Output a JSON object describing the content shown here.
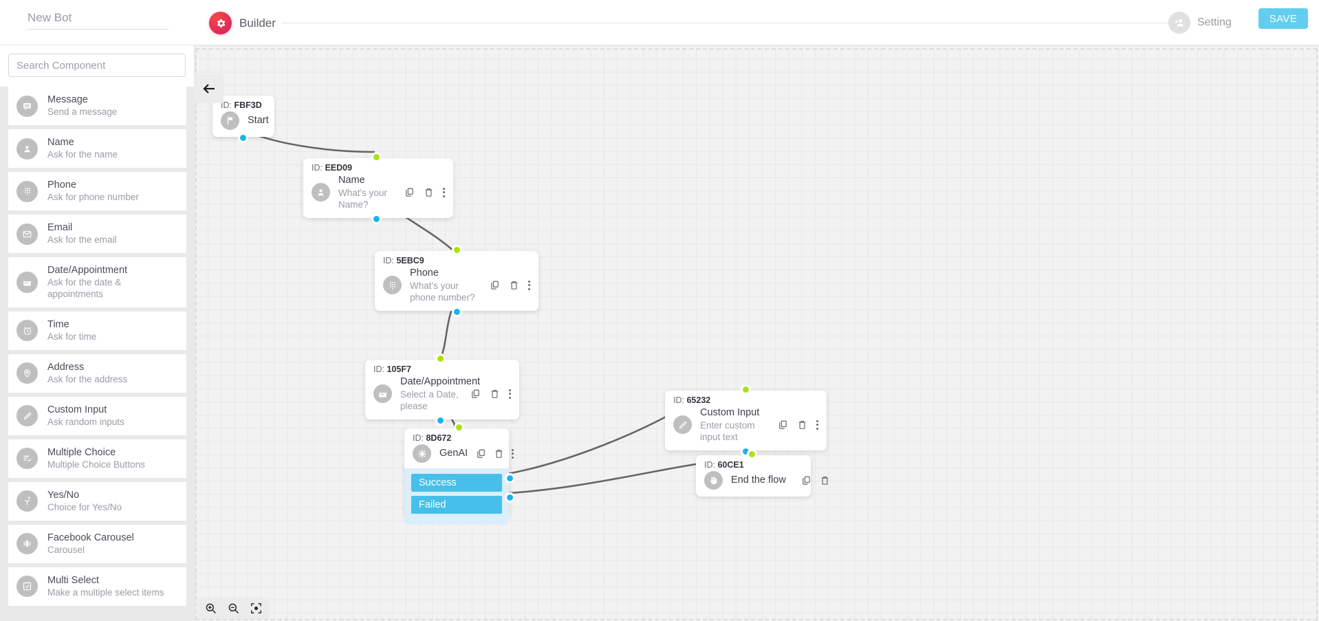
{
  "header": {
    "bot_name_value": "New Bot",
    "bot_name_placeholder": "New Bot",
    "builder_label": "Builder",
    "setting_label": "Setting",
    "save_label": "SAVE",
    "accent_color": "#63cdf0",
    "builder_badge_color": "#e8334f"
  },
  "sidebar": {
    "search_placeholder": "Search Component",
    "search_value": "",
    "items": [
      {
        "title": "Message",
        "sub": "Send a message",
        "icon": "message-icon"
      },
      {
        "title": "Name",
        "sub": "Ask for the name",
        "icon": "person-icon"
      },
      {
        "title": "Phone",
        "sub": "Ask for phone number",
        "icon": "keypad-icon"
      },
      {
        "title": "Email",
        "sub": "Ask for the email",
        "icon": "envelope-icon"
      },
      {
        "title": "Date/Appointment",
        "sub": "Ask for the date & appointments",
        "icon": "calendar-icon"
      },
      {
        "title": "Time",
        "sub": "Ask for time",
        "icon": "clock-icon"
      },
      {
        "title": "Address",
        "sub": "Ask for the address",
        "icon": "map-pin-icon"
      },
      {
        "title": "Custom Input",
        "sub": "Ask random inputs",
        "icon": "pencil-icon"
      },
      {
        "title": "Multiple Choice",
        "sub": "Multiple Choice Buttons",
        "icon": "list-check-icon"
      },
      {
        "title": "Yes/No",
        "sub": "Choice for Yes/No",
        "icon": "fork-icon"
      },
      {
        "title": "Facebook Carousel",
        "sub": "Carousel",
        "icon": "carousel-icon"
      },
      {
        "title": "Multi Select",
        "sub": "Make a multiple select items",
        "icon": "checkbox-icon"
      }
    ]
  },
  "canvas": {
    "collapse_icon": "arrow-left-icon",
    "zoom_in_label": "zoom-in",
    "zoom_out_label": "zoom-out",
    "fit_label": "fit-to-screen",
    "port_in_color": "#a8e213",
    "port_out_color": "#1ab4f0",
    "edge_color": "#666666",
    "nodes": [
      {
        "id_label": "ID:",
        "id": "FBF3D",
        "title": "Start",
        "sub": "",
        "icon": "flag-icon",
        "actions": []
      },
      {
        "id_label": "ID:",
        "id": "EED09",
        "title": "Name",
        "sub": "What's your Name?",
        "icon": "person-icon",
        "actions": [
          "copy-icon",
          "trash-icon",
          "more-icon"
        ]
      },
      {
        "id_label": "ID:",
        "id": "5EBC9",
        "title": "Phone",
        "sub": "What's your phone number?",
        "icon": "keypad-icon",
        "actions": [
          "copy-icon",
          "trash-icon",
          "more-icon"
        ]
      },
      {
        "id_label": "ID:",
        "id": "105F7",
        "title": "Date/Appointment",
        "sub": "Select a Date, please",
        "icon": "calendar-icon",
        "actions": [
          "copy-icon",
          "trash-icon",
          "more-icon"
        ]
      },
      {
        "id_label": "ID:",
        "id": "8D672",
        "title": "GenAI",
        "sub": "",
        "icon": "sparkle-icon",
        "actions": [
          "copy-icon",
          "trash-icon",
          "more-icon"
        ],
        "branches": [
          "Success",
          "Failed"
        ]
      },
      {
        "id_label": "ID:",
        "id": "65232",
        "title": "Custom Input",
        "sub": "Enter custom input text",
        "icon": "pencil-icon",
        "actions": [
          "copy-icon",
          "trash-icon",
          "more-icon"
        ]
      },
      {
        "id_label": "ID:",
        "id": "60CE1",
        "title": "End the flow",
        "sub": "",
        "icon": "hand-stop-icon",
        "actions": [
          "copy-icon",
          "trash-icon"
        ]
      }
    ]
  }
}
